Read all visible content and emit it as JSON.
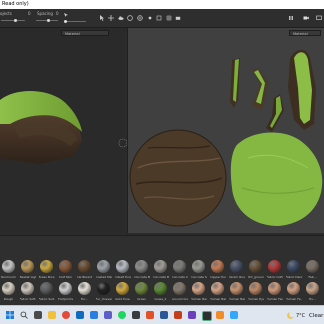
{
  "titlebar": {
    "text": "Read only)"
  },
  "toolbar": {
    "label_a": "ojects",
    "value_a": "0",
    "label_b": "Spacing",
    "value_b": "0"
  },
  "viewports": {
    "left_material": "Material",
    "right_material": "Material"
  },
  "materials_row1": [
    {
      "name": "Aluminum Bl...",
      "color": "#c6c6c6"
    },
    {
      "name": "Basket Light...",
      "color": "#bf9b5a"
    },
    {
      "name": "Brass Pure",
      "color": "#c9a93f"
    },
    {
      "name": "Calf Skin",
      "color": "#8a5a38"
    },
    {
      "name": "Cardboard Chat",
      "color": "#6b4e33"
    },
    {
      "name": "Coated Metal",
      "color": "#9da3a8"
    },
    {
      "name": "Cobalt Pure",
      "color": "#b8bcc4"
    },
    {
      "name": "Concrete B...",
      "color": "#8e8e8e"
    },
    {
      "name": "Concrete Bl...",
      "color": "#a09e98"
    },
    {
      "name": "Concrete Cl...",
      "color": "#7e7d79"
    },
    {
      "name": "Concrete Sl...",
      "color": "#9b9b95"
    },
    {
      "name": "Copper Pure",
      "color": "#c57b53"
    },
    {
      "name": "Denim Rivet",
      "color": "#49536a"
    },
    {
      "name": "dirt_ground",
      "color": "#6a533a"
    },
    {
      "name": "Fabric Cotton",
      "color": "#b63a3a"
    },
    {
      "name": "Fabric Denim",
      "color": "#3e4c68"
    },
    {
      "name": "Fab...",
      "color": "#7a6f64"
    }
  ],
  "materials_row2": [
    {
      "name": "Rough",
      "color": "#d9d0c4"
    },
    {
      "name": "Fabric Soft...",
      "color": "#d0c7bd"
    },
    {
      "name": "Fabric Suit...",
      "color": "#5f5f63"
    },
    {
      "name": "Footprints",
      "color": "#cfcfcf"
    },
    {
      "name": "Fur...",
      "color": "#e6e1d6"
    },
    {
      "name": "Fur_Uneven...",
      "color": "#222222"
    },
    {
      "name": "Gold Pure",
      "color": "#d2a93d"
    },
    {
      "name": "Grass",
      "color": "#6f8a3b"
    },
    {
      "name": "Grass_2",
      "color": "#5b8a34"
    },
    {
      "name": "Ground Gravel",
      "color": "#85796a"
    },
    {
      "name": "Human Bac...",
      "color": "#d7a587"
    },
    {
      "name": "Human Bell...",
      "color": "#d6a385"
    },
    {
      "name": "Human Bell...",
      "color": "#c8926f"
    },
    {
      "name": "Human Eye...",
      "color": "#c08865"
    },
    {
      "name": "Human Fac...",
      "color": "#cf9a7b"
    },
    {
      "name": "Human Fe...",
      "color": "#d4a183"
    },
    {
      "name": "Hu...",
      "color": "#caa58a"
    }
  ],
  "taskbar": {
    "temperature": "7°C",
    "weather": "Clear"
  },
  "colors": {
    "grass": "#7fb23a",
    "dirt": "#4d3a28",
    "viewport_bg": "#404040"
  }
}
